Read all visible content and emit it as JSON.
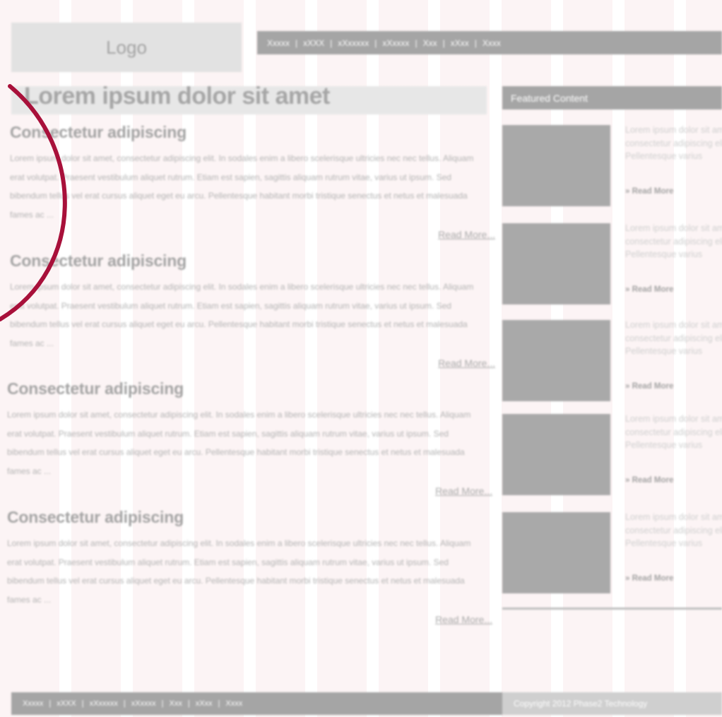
{
  "header": {
    "logo_text": "Logo",
    "nav": [
      "Xxxxx",
      "xXXX",
      "xXxxxxx",
      "xXxxxx",
      "Xxx",
      "xXxx",
      "Xxxx"
    ],
    "nav_separator": "|"
  },
  "main": {
    "page_title": "Lorem ipsum dolor sit amet",
    "articles": [
      {
        "heading": "Consectetur adipiscing",
        "body": "Lorem ipsum dolor sit amet, consectetur adipiscing elit. In sodales enim a libero scelerisque ultricies nec nec tellus. Aliquam erat volutpat. Praesent vestibulum aliquet rutrum. Etiam est sapien, sagittis aliquam rutrum vitae, varius ut ipsum. Sed bibendum tellus vel erat cursus aliquet eget eu arcu. Pellentesque habitant morbi tristique senectus et netus et malesuada fames ac ...",
        "read_more": "Read More..."
      },
      {
        "heading": "Consectetur adipiscing",
        "body": "Lorem ipsum dolor sit amet, consectetur adipiscing elit. In sodales enim a libero scelerisque ultricies nec nec tellus. Aliquam erat volutpat. Praesent vestibulum aliquet rutrum. Etiam est sapien, sagittis aliquam rutrum vitae, varius ut ipsum. Sed bibendum tellus vel erat cursus aliquet eget eu arcu. Pellentesque habitant morbi tristique senectus et netus et malesuada fames ac ...",
        "read_more": "Read More..."
      },
      {
        "heading": "Consectetur adipiscing",
        "body": "Lorem ipsum dolor sit amet, consectetur adipiscing elit. In sodales enim a libero scelerisque ultricies nec nec tellus. Aliquam erat volutpat. Praesent vestibulum aliquet rutrum. Etiam est sapien, sagittis aliquam rutrum vitae, varius ut ipsum. Sed bibendum tellus vel erat cursus aliquet eget eu arcu. Pellentesque habitant morbi tristique senectus et netus et malesuada fames ac ...",
        "read_more": "Read More..."
      },
      {
        "heading": "Consectetur adipiscing",
        "body": "Lorem ipsum dolor sit amet, consectetur adipiscing elit. In sodales enim a libero scelerisque ultricies nec nec tellus. Aliquam erat volutpat. Praesent vestibulum aliquet rutrum. Etiam est sapien, sagittis aliquam rutrum vitae, varius ut ipsum. Sed bibendum tellus vel erat cursus aliquet eget eu arcu. Pellentesque habitant morbi tristique senectus et netus et malesuada fames ac ...",
        "read_more": "Read More..."
      }
    ]
  },
  "sidebar": {
    "title": "Featured Content",
    "items": [
      {
        "text": "Lorem ipsum dolor sit amet, consectetur adipiscing elit. Pellentesque varius",
        "more": "» Read More"
      },
      {
        "text": "Lorem ipsum dolor sit amet, consectetur adipiscing elit. Pellentesque varius",
        "more": "» Read More"
      },
      {
        "text": "Lorem ipsum dolor sit amet, consectetur adipiscing elit. Pellentesque varius",
        "more": "» Read More"
      },
      {
        "text": "Lorem ipsum dolor sit amet, consectetur adipiscing elit. Pellentesque varius",
        "more": "» Read More"
      },
      {
        "text": "Lorem ipsum dolor sit amet, consectetur adipiscing elit. Pellentesque varius",
        "more": "» Read More"
      }
    ]
  },
  "footer": {
    "nav": [
      "Xxxxx",
      "xXXX",
      "xXxxxxx",
      "xXxxxx",
      "Xxx",
      "xXxx",
      "Xxxx"
    ],
    "copyright": "Copyright 2012 Phase2 Technology"
  },
  "colors": {
    "bar_gray": "#a5a5a5",
    "light_gray": "#e2e2e2",
    "grid_pink": "#f6dcde",
    "annotation_arc": "#a8103a"
  },
  "annotation": {
    "shape": "circle-arc"
  }
}
